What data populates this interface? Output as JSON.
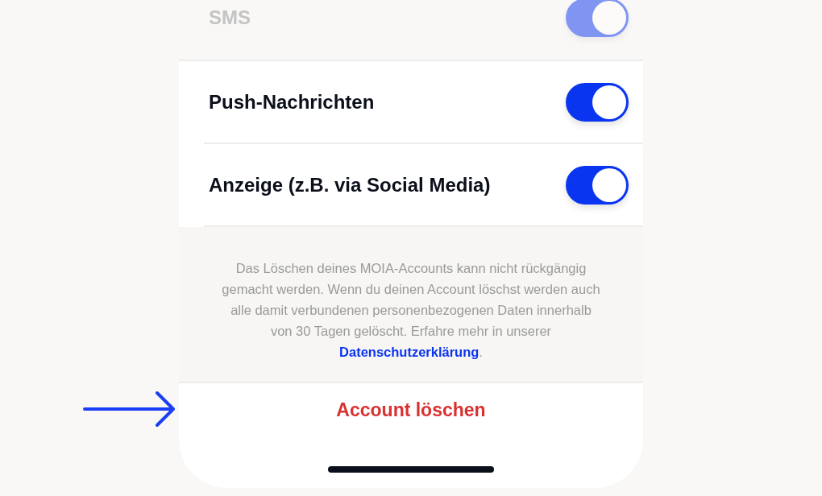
{
  "settings": [
    {
      "label": "SMS",
      "on": true
    },
    {
      "label": "Push-Nachrichten",
      "on": true
    },
    {
      "label": "Anzeige (z.B. via Social Media)",
      "on": true
    }
  ],
  "info": {
    "text": "Das Löschen deines MOIA-Accounts kann nicht rückgängig gemacht werden. Wenn du deinen Account löschst werden auch alle damit verbundenen personenbezogenen Daten innerhalb von 30 Tagen gelöscht. Erfahre mehr in unserer",
    "link": "Datenschutzerklärung",
    "after": "."
  },
  "delete_button": "Account löschen"
}
